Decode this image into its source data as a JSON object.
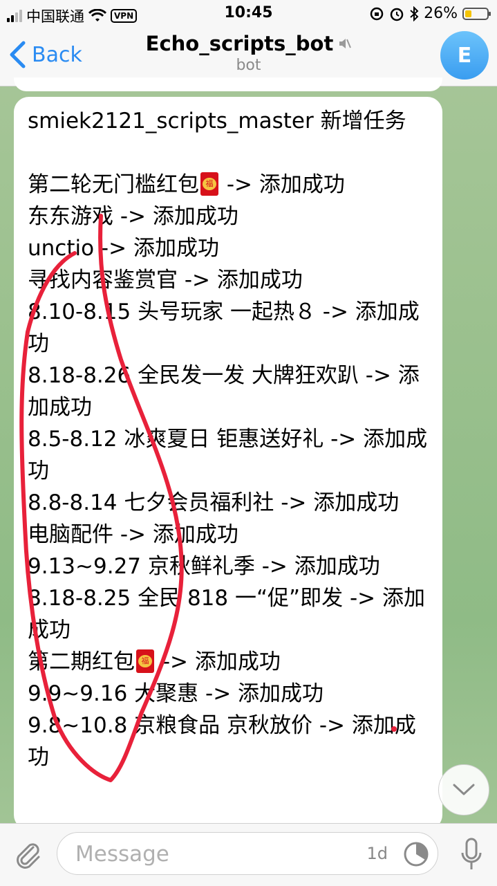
{
  "status_bar": {
    "carrier": "中国联通",
    "vpn": "VPN",
    "time": "10:45",
    "battery": "26%"
  },
  "nav": {
    "back_label": "Back",
    "title": "Echo_scripts_bot",
    "subtitle": "bot",
    "avatar_letter": "E"
  },
  "message": {
    "lines": [
      "smiek2121_scripts_master 新增任务",
      "",
      "第二轮无门槛红包🧧 -> 添加成功",
      "东东游戏 -> 添加成功",
      "unctio -> 添加成功",
      "寻找内容鉴赏官 -> 添加成功",
      "8.10-8.15 头号玩家 一起热８ -> 添加成功",
      "8.18-8.26 全民发一发 大牌狂欢趴 -> 添加成功",
      "8.5-8.12 冰爽夏日 钜惠送好礼 -> 添加成功",
      "8.8-8.14 七夕会员福利社 -> 添加成功",
      "电脑配件 -> 添加成功",
      "9.13~9.27 京秋鲜礼季 -> 添加成功",
      "8.18-8.25 全民 818 一“促”即发 -> 添加成功",
      "第二期红包🧧 -> 添加成功",
      "9.9~9.16 大聚惠 -> 添加成功",
      "9.8~10.8 京粮食品 京秋放价 -> 添加成功"
    ]
  },
  "input": {
    "placeholder": "Message",
    "timer_label": "1d"
  },
  "colors": {
    "accent": "#2a8bf2",
    "annotation": "#e8213a",
    "red_packet": "#d7111a"
  }
}
